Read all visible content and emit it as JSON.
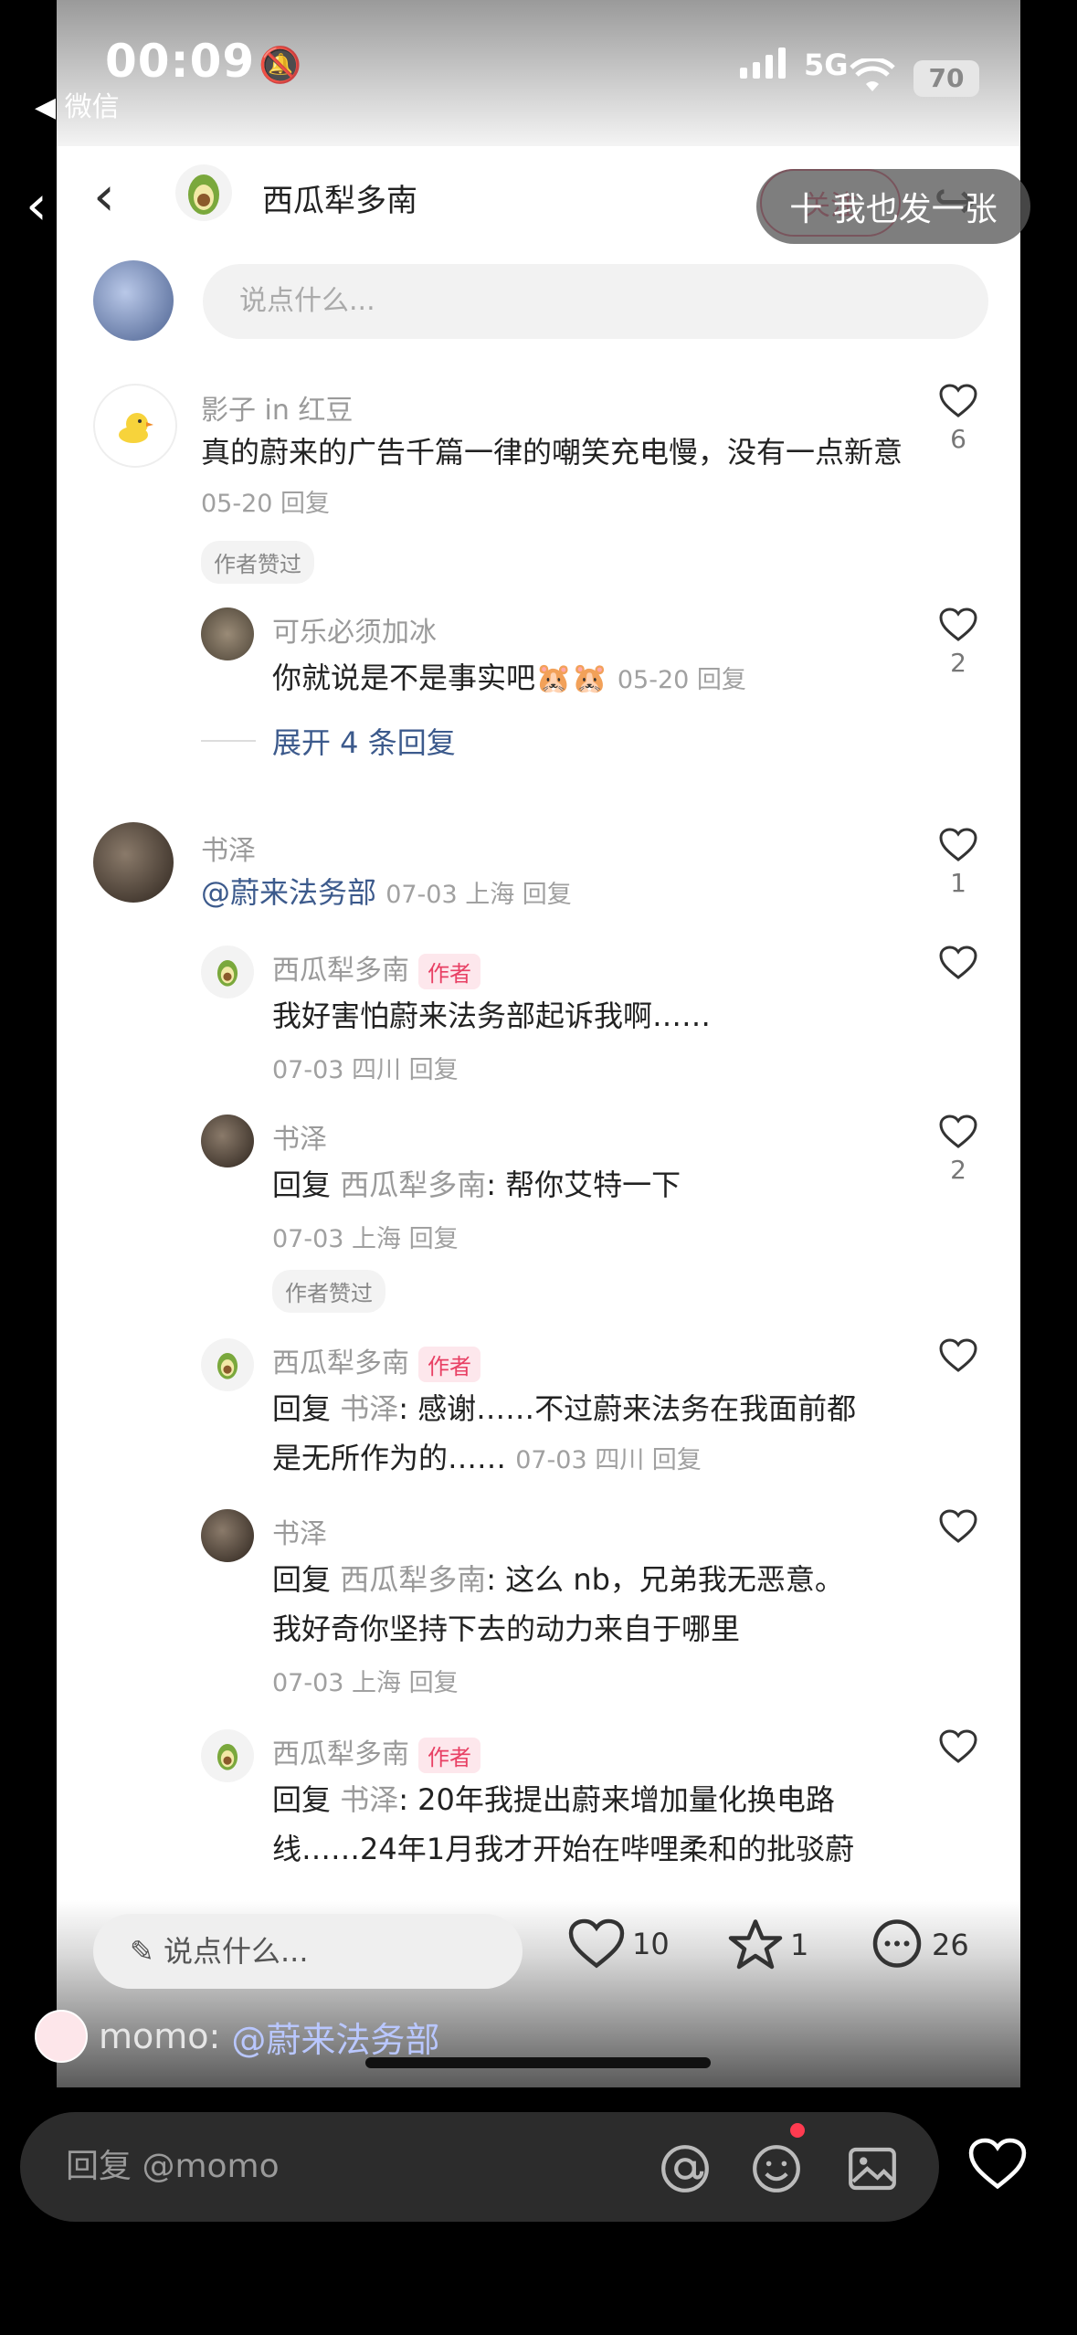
{
  "status": {
    "time": "00:09",
    "back_app": "◀ 微信",
    "network": "5G",
    "battery": "70"
  },
  "nav": {
    "title": "西瓜犁多南",
    "follow": "关注"
  },
  "my_input": {
    "placeholder": "说点什么..."
  },
  "comments": [
    {
      "name": "影子 in 红豆",
      "text": "真的蔚来的广告千篇一律的嘲笑充电慢，没有一点新意",
      "meta": "05-20 回复",
      "badge": "作者赞过",
      "likes": "6"
    },
    {
      "name": "可乐必须加冰",
      "text": "你就说是不是事实吧",
      "meta": "05-20 回复",
      "likes": "2"
    },
    {
      "expand": "展开 4 条回复"
    },
    {
      "name": "书泽",
      "mention": "@蔚来法务部",
      "meta": "07-03 上海 回复",
      "likes": "1"
    },
    {
      "name": "西瓜犁多南",
      "author_badge": "作者",
      "text": "我好害怕蔚来法务部起诉我啊……",
      "meta": "07-03 四川 回复"
    },
    {
      "name": "书泽",
      "reply_prefix": "回复",
      "reply_to": "西瓜犁多南",
      "text": ": 帮你艾特一下",
      "meta": "07-03 上海 回复",
      "badge": "作者赞过",
      "likes": "2"
    },
    {
      "name": "西瓜犁多南",
      "author_badge": "作者",
      "reply_prefix": "回复",
      "reply_to": "书泽",
      "text1": ": 感谢……不过蔚来法务在我面前都",
      "text2": "是无所作为的……",
      "meta": "07-03 四川 回复"
    },
    {
      "name": "书泽",
      "reply_prefix": "回复",
      "reply_to": "西瓜犁多南",
      "text1": ": 这么 nb，兄弟我无恶意。",
      "text2": "我好奇你坚持下去的动力来自于哪里",
      "meta": "07-03 上海 回复"
    },
    {
      "name": "西瓜犁多南",
      "author_badge": "作者",
      "reply_prefix": "回复",
      "reply_to": "书泽",
      "text1": ": 20年我提出蔚来增加量化换电路",
      "text2": "线……24年1月我才开始在哔哩柔和的批驳蔚"
    }
  ],
  "inner_bottom": {
    "placeholder": "说点什么...",
    "likes": "10",
    "stars": "1",
    "comments": "26"
  },
  "overlay": {
    "button": "十 我也发一张",
    "danmaku_user": "momo:",
    "danmaku_msg": "@蔚来法务部"
  },
  "reply_bar": {
    "placeholder": "回复 @momo"
  }
}
